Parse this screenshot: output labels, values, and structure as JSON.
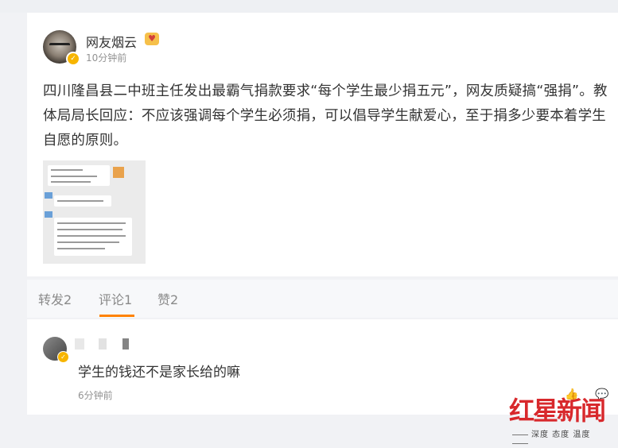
{
  "post": {
    "username": "网友烟云",
    "vip_badge": "♥",
    "time": "10分钟前",
    "text": "四川隆昌县二中班主任发出最霸气捐款要求“每个学生最少捐五元”，网友质疑搞“强捐”。教体局局长回应：不应该强调每个学生必须捐，可以倡导学生献爱心，至于捐多少要本着学生自愿的原则。"
  },
  "tabs": [
    {
      "label": "转发2"
    },
    {
      "label": "评论1"
    },
    {
      "label": "赞2"
    }
  ],
  "comment": {
    "text": "学生的钱还不是家长给的嘛",
    "time": "6分钟前"
  },
  "watermark": {
    "logo_red": "红星",
    "logo_news": "新闻",
    "tagline": "深度 态度 温度"
  },
  "colors": {
    "accent": "#ff8200",
    "brand_red": "#d8282c",
    "verified": "#f7b500"
  }
}
